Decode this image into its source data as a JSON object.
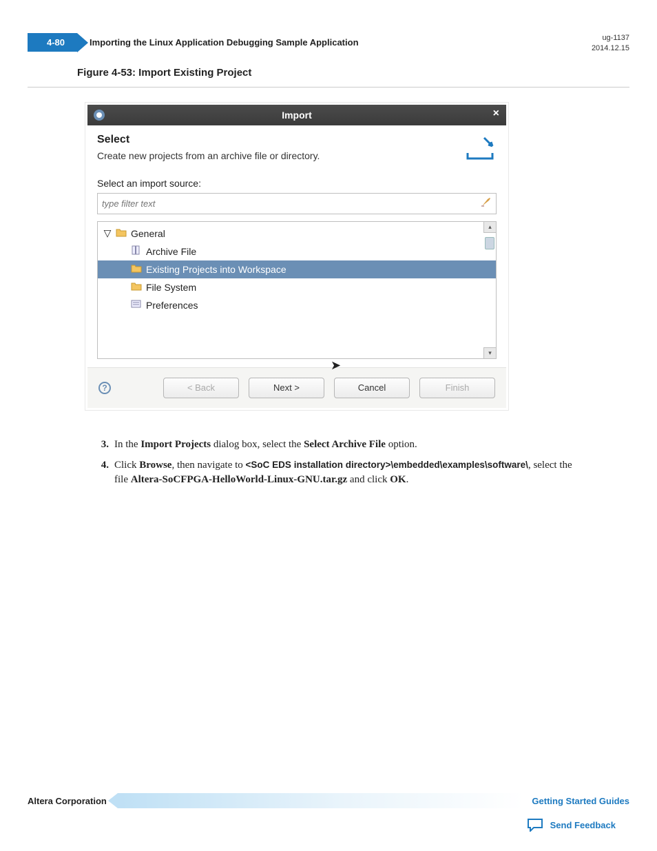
{
  "header": {
    "page_number": "4-80",
    "title": "Importing the Linux Application Debugging Sample Application",
    "doc_id": "ug-1137",
    "date": "2014.12.15"
  },
  "figure": {
    "caption": "Figure 4-53: Import Existing Project"
  },
  "dialog": {
    "title": "Import",
    "section_heading": "Select",
    "section_desc": "Create new projects from an archive file or directory.",
    "source_label": "Select an import source:",
    "filter_placeholder": "type filter text",
    "tree": {
      "root": "General",
      "items": [
        "Archive File",
        "Existing Projects into Workspace",
        "File System",
        "Preferences"
      ],
      "selected_index": 1
    },
    "buttons": {
      "back": "< Back",
      "next": "Next >",
      "cancel": "Cancel",
      "finish": "Finish"
    }
  },
  "steps": [
    {
      "n": "3.",
      "parts": [
        "In the ",
        "Import Projects",
        " dialog box, select the ",
        "Select Archive File",
        " option."
      ]
    },
    {
      "n": "4.",
      "line1_parts": [
        "Click ",
        "Browse",
        ", then navigate to ",
        "<SoC EDS installation directory>\\embedded\\examples\\software\\",
        ", select the"
      ],
      "line2_parts": [
        "file ",
        "Altera-SoCFPGA-HelloWorld-Linux-GNU.tar.gz",
        " and click ",
        "OK",
        "."
      ]
    }
  ],
  "footer": {
    "corp": "Altera Corporation",
    "guide_link": "Getting Started Guides",
    "feedback": "Send Feedback"
  }
}
